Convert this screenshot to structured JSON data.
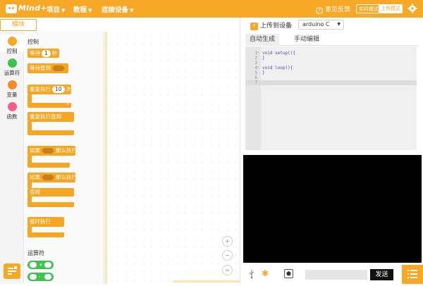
{
  "app": {
    "logo_text": "Mind+",
    "menu": {
      "project": "项目",
      "tutorial": "教程",
      "connect": "连接设备"
    },
    "feedback": "意见反馈",
    "mode_live": "实时模式",
    "mode_upload": "上传模式"
  },
  "left": {
    "modules_tab": "模块",
    "categories": {
      "control": "控制",
      "operator": "运算符",
      "variable": "变量",
      "function": "函数"
    }
  },
  "palette": {
    "control_title": "控制",
    "operator_title": "运算符",
    "blocks": {
      "wait": "等待",
      "wait_value": "1",
      "wait_unit": "秒",
      "wait_until": "等待直到",
      "repeat": "重复执行",
      "repeat_value": "10",
      "repeat_unit": "次",
      "repeat_until": "重复执行直到",
      "if": "如果",
      "then": "那么执行",
      "if2": "如果",
      "then2": "那么执行",
      "else": "否则",
      "forever": "循环执行"
    },
    "operators": {
      "add": "+",
      "sub": "-"
    }
  },
  "workspace": {
    "zoom_in": "+",
    "zoom_out": "−",
    "zoom_reset": "="
  },
  "right": {
    "upload_label": "上传到设备",
    "language": "arduino C",
    "tabs": {
      "auto": "自动生成",
      "manual": "手动编辑"
    },
    "code": [
      {
        "n": "1",
        "fold": "▾",
        "text": "void setup(){"
      },
      {
        "n": "2",
        "fold": "",
        "text": "}"
      },
      {
        "n": "3",
        "fold": "",
        "text": ""
      },
      {
        "n": "4",
        "fold": "▾",
        "text": "void loop(){"
      },
      {
        "n": "5",
        "fold": "",
        "text": "}"
      },
      {
        "n": "6",
        "fold": "",
        "text": ""
      },
      {
        "n": "7",
        "fold": "",
        "text": ""
      }
    ],
    "send_button": "发送",
    "send_input_value": ""
  },
  "colors": {
    "accent": "#f7a827",
    "control_block": "#f5a623",
    "operator": "#3cc44c",
    "variable": "#f58a26",
    "function": "#f25e88",
    "serial_bg": "#000000"
  }
}
